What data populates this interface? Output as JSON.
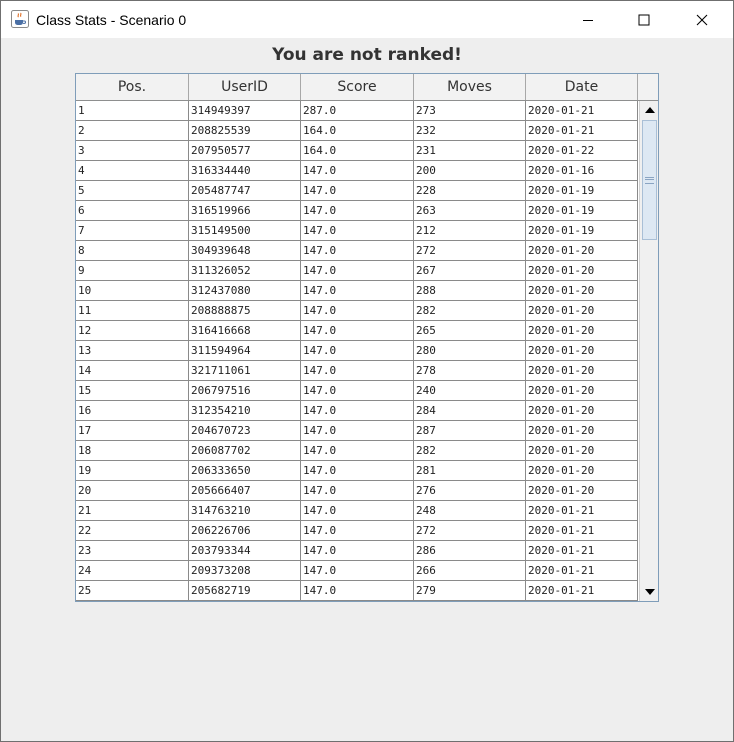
{
  "window": {
    "title": "Class Stats - Scenario 0",
    "app_icon": "java-coffee-cup-icon"
  },
  "heading": "You are not ranked!",
  "table": {
    "columns": [
      "Pos.",
      "UserID",
      "Score",
      "Moves",
      "Date"
    ],
    "rows": [
      [
        "1",
        "314949397",
        "287.0",
        "273",
        "2020-01-21"
      ],
      [
        "2",
        "208825539",
        "164.0",
        "232",
        "2020-01-21"
      ],
      [
        "3",
        "207950577",
        "164.0",
        "231",
        "2020-01-22"
      ],
      [
        "4",
        "316334440",
        "147.0",
        "200",
        "2020-01-16"
      ],
      [
        "5",
        "205487747",
        "147.0",
        "228",
        "2020-01-19"
      ],
      [
        "6",
        "316519966",
        "147.0",
        "263",
        "2020-01-19"
      ],
      [
        "7",
        "315149500",
        "147.0",
        "212",
        "2020-01-19"
      ],
      [
        "8",
        "304939648",
        "147.0",
        "272",
        "2020-01-20"
      ],
      [
        "9",
        "311326052",
        "147.0",
        "267",
        "2020-01-20"
      ],
      [
        "10",
        "312437080",
        "147.0",
        "288",
        "2020-01-20"
      ],
      [
        "11",
        "208888875",
        "147.0",
        "282",
        "2020-01-20"
      ],
      [
        "12",
        "316416668",
        "147.0",
        "265",
        "2020-01-20"
      ],
      [
        "13",
        "311594964",
        "147.0",
        "280",
        "2020-01-20"
      ],
      [
        "14",
        "321711061",
        "147.0",
        "278",
        "2020-01-20"
      ],
      [
        "15",
        "206797516",
        "147.0",
        "240",
        "2020-01-20"
      ],
      [
        "16",
        "312354210",
        "147.0",
        "284",
        "2020-01-20"
      ],
      [
        "17",
        "204670723",
        "147.0",
        "287",
        "2020-01-20"
      ],
      [
        "18",
        "206087702",
        "147.0",
        "282",
        "2020-01-20"
      ],
      [
        "19",
        "206333650",
        "147.0",
        "281",
        "2020-01-20"
      ],
      [
        "20",
        "205666407",
        "147.0",
        "276",
        "2020-01-20"
      ],
      [
        "21",
        "314763210",
        "147.0",
        "248",
        "2020-01-21"
      ],
      [
        "22",
        "206226706",
        "147.0",
        "272",
        "2020-01-21"
      ],
      [
        "23",
        "203793344",
        "147.0",
        "286",
        "2020-01-21"
      ],
      [
        "24",
        "209373208",
        "147.0",
        "266",
        "2020-01-21"
      ],
      [
        "25",
        "205682719",
        "147.0",
        "279",
        "2020-01-21"
      ]
    ]
  },
  "scrollbar": {
    "icons": [
      "scroll-up-arrow-icon",
      "scroll-down-arrow-icon",
      "scroll-thumb-grip-icon"
    ]
  }
}
